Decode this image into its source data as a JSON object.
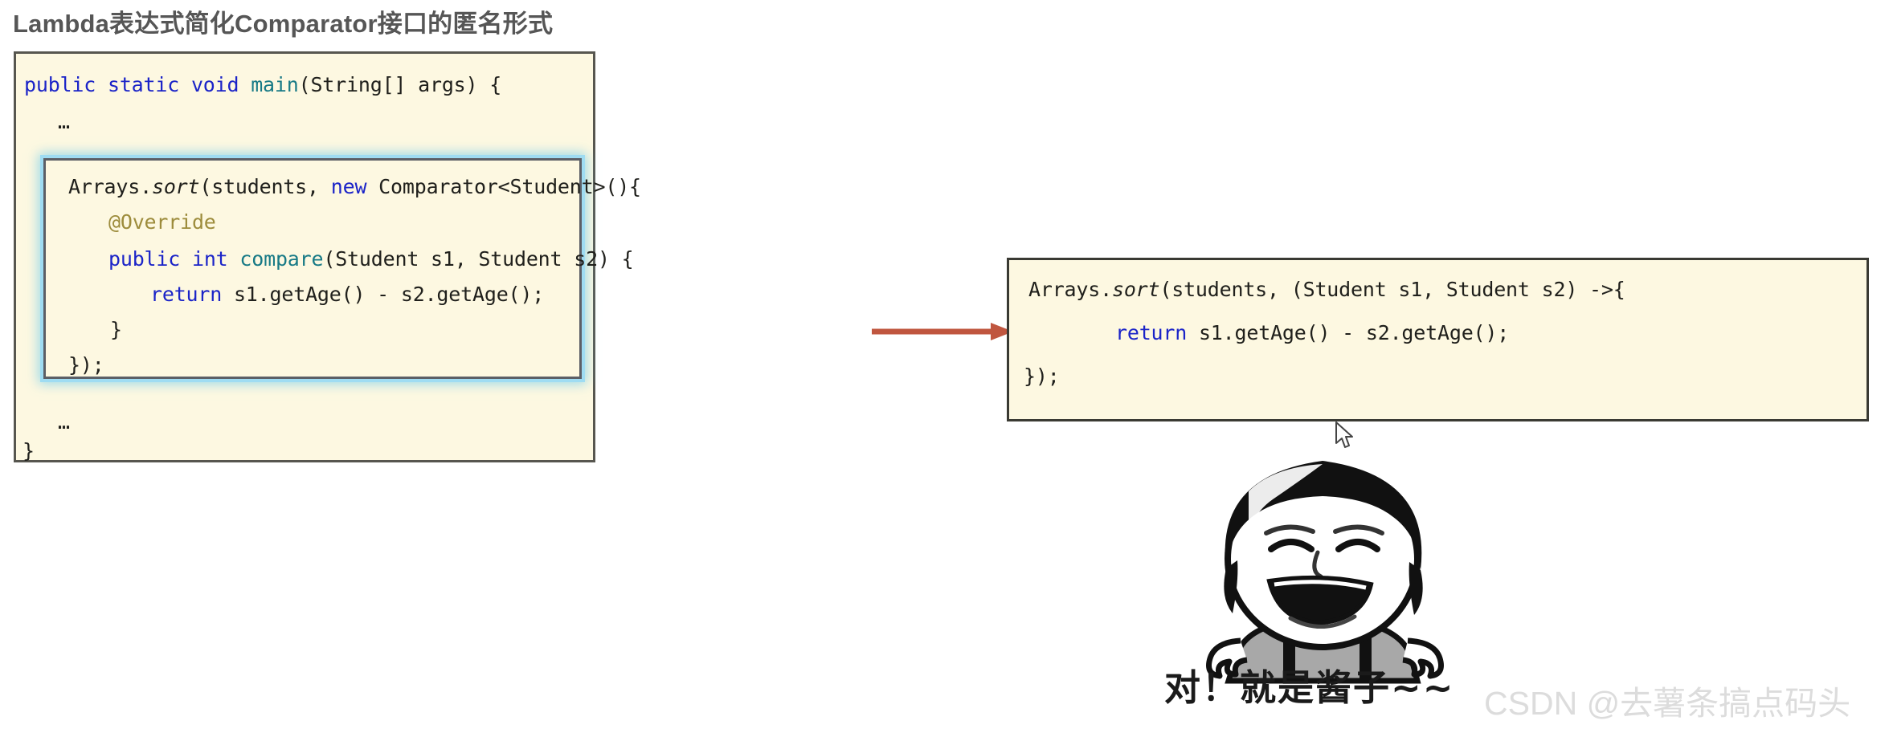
{
  "title": "Lambda表达式简化Comparator接口的匿名形式",
  "left_code_box": {
    "line1": {
      "kw1": "public",
      "kw2": "static",
      "kw3": "void",
      "method": "main",
      "rest": "(String[] args) {"
    },
    "ellipsis_top": "…",
    "ellipsis_bottom": "…",
    "closing_brace": "}"
  },
  "inner_code_box": {
    "line1_a": "Arrays.",
    "line1_sort": "sort",
    "line1_b": "(students, ",
    "line1_new": "new",
    "line1_c": " Comparator<Student>(){",
    "line2_override": "@Override",
    "line3_kw1": "public",
    "line3_kw2": "int",
    "line3_method": "compare",
    "line3_rest": "(Student s1, Student s2) {",
    "line4_return": "return",
    "line4_rest": " s1.getAge() - s2.getAge();",
    "line5_brace": "}",
    "line6_close": "});"
  },
  "right_code_box": {
    "line1_a": "Arrays.",
    "line1_sort": "sort",
    "line1_b": "(students, (Student s1, Student s2) ->{",
    "line2_return": "return",
    "line2_rest": " s1.getAge() - s2.getAge();",
    "line3_close": "});"
  },
  "meme": {
    "caption": "对！就是酱子~~",
    "icon": "laughing-character-meme"
  },
  "watermark": "CSDN @去薯条搞点码头",
  "colors": {
    "title": "#565656",
    "code_bg": "#FDF8E1",
    "outer_border": "#57564F",
    "inner_border": "#5C5F66",
    "inner_glow": "#9FDCF2",
    "right_border": "#3A3A33",
    "keyword": "#1b24c8",
    "method": "#187a86",
    "annotation": "#9d8c3c",
    "arrow": "#C0563F",
    "watermark": "#DCDCDC"
  }
}
